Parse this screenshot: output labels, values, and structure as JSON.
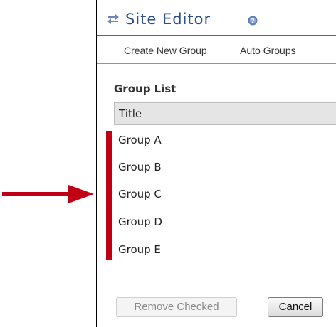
{
  "header": {
    "title": "Site Editor"
  },
  "tabs": [
    {
      "label": "Create New Group"
    },
    {
      "label": "Auto Groups"
    }
  ],
  "group_list": {
    "heading": "Group List",
    "column_title": "Title",
    "groups": [
      "Group A",
      "Group B",
      "Group C",
      "Group D",
      "Group E"
    ]
  },
  "buttons": {
    "remove_checked": "Remove Checked",
    "cancel": "Cancel"
  },
  "colors": {
    "title_text": "#2c4f86",
    "header_underline": "#c4383e",
    "annotation_red": "#c00014"
  },
  "icons": {
    "header_left": "sync-icon",
    "header_right": "help-icon"
  }
}
